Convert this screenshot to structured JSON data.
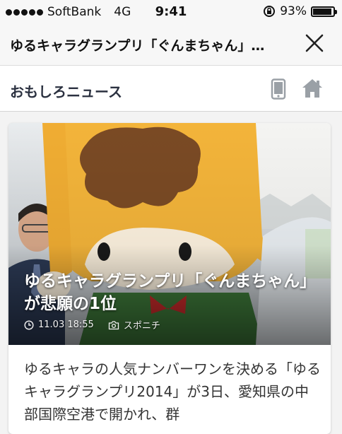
{
  "status_bar": {
    "carrier": "SoftBank",
    "network": "4G",
    "time": "9:41",
    "battery_percent": "93%",
    "battery_level": 0.93
  },
  "header": {
    "title": "ゆるキャラグランプリ「ぐんまちゃん」…",
    "close_icon": "close-icon"
  },
  "subnav": {
    "site_name": "おもしろニュース",
    "icons": [
      "mobile-phone-icon",
      "home-icon"
    ]
  },
  "article": {
    "headline": "ゆるキャラグランプリ「ぐんまちゃん」が悲願の1位",
    "date": "11.03 18:55",
    "source": "スポニチ",
    "body": "ゆるキャラの人気ナンバーワンを決める「ゆるキャラグランプリ2014」が3日、愛知県の中部国際空港で開かれ、群"
  },
  "colors": {
    "bar_background": "#f7f7f7",
    "site_name": "#2b3140",
    "icon_gray": "#9aa0a6"
  }
}
